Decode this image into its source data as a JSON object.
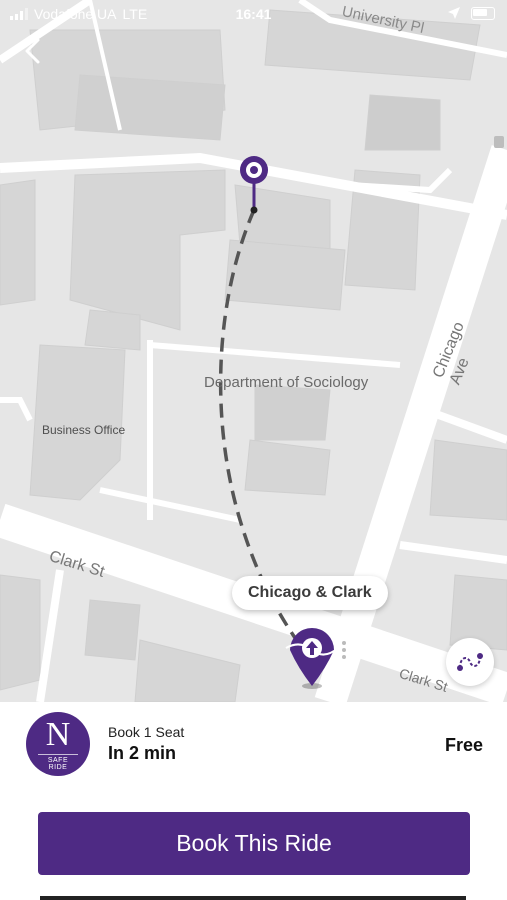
{
  "status_bar": {
    "carrier": "Vodafone UA",
    "network": "LTE",
    "time": "16:41"
  },
  "map": {
    "labels": {
      "university": "University Pl",
      "sociology": "Department of Sociology",
      "business_office": "Business Office",
      "clark_st_1": "Clark St",
      "clark_st_2": "Clark St",
      "chicago_ave": "Chicago Ave"
    },
    "pickup_callout": "Chicago & Clark",
    "route_color": "#555555",
    "pin_color": "#4e2a84"
  },
  "ride": {
    "logo_letter": "N",
    "logo_subtitle": "SAFE RIDE",
    "seat_label": "Book 1 Seat",
    "eta": "In 2 min",
    "price": "Free"
  },
  "actions": {
    "book_button": "Book This Ride"
  },
  "icons": {
    "back": "chevron-left-icon",
    "location": "location-arrow-icon",
    "battery": "battery-icon",
    "route_toggle": "route-icon"
  },
  "colors": {
    "brand": "#4e2a84",
    "map_bg": "#e6e6e6",
    "road": "#ffffff"
  }
}
